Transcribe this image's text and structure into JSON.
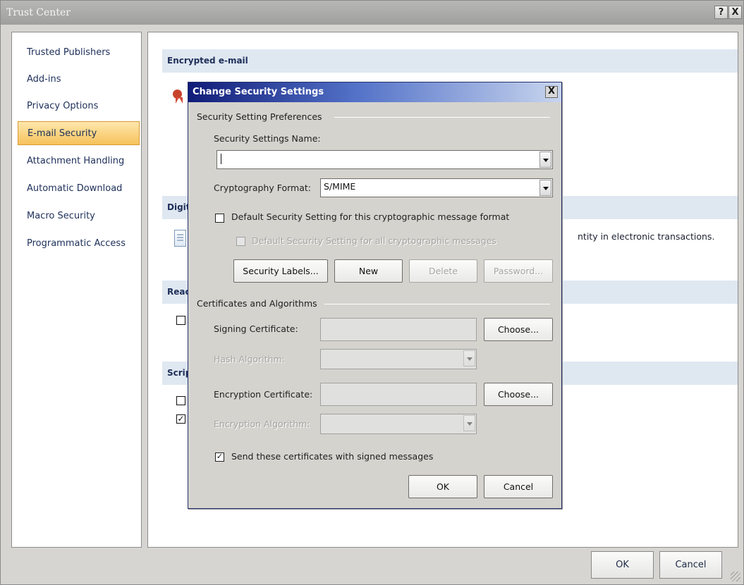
{
  "window": {
    "title": "Trust Center",
    "help_label": "?",
    "close_label": "X"
  },
  "sidebar": {
    "items": [
      {
        "label": "Trusted Publishers"
      },
      {
        "label": "Add-ins"
      },
      {
        "label": "Privacy Options"
      },
      {
        "label": "E-mail Security",
        "selected": true
      },
      {
        "label": "Attachment Handling"
      },
      {
        "label": "Automatic Download"
      },
      {
        "label": "Macro Security"
      },
      {
        "label": "Programmatic Access"
      }
    ]
  },
  "main": {
    "sections": [
      {
        "title": "Encrypted e-mail"
      },
      {
        "title": "Digit"
      },
      {
        "title": "Reac"
      },
      {
        "title": "Scrip"
      }
    ],
    "visible_text": {
      "digital_id_text": "ntity in electronic transactions."
    },
    "checkboxes": [
      {
        "checked": false
      },
      {
        "checked": false
      },
      {
        "checked": true
      }
    ]
  },
  "footer": {
    "ok_label": "OK",
    "cancel_label": "Cancel"
  },
  "dialog": {
    "title": "Change Security Settings",
    "close_label": "X",
    "preferences": {
      "group_label": "Security Setting Preferences",
      "name_label": "Security Settings Name:",
      "name_value": "",
      "crypto_label": "Cryptography Format:",
      "crypto_value": "S/MIME",
      "default_format_label": "Default Security Setting for this cryptographic message format",
      "default_format_checked": false,
      "default_all_label": "Default Security Setting for all cryptographic messages",
      "default_all_checked": false
    },
    "buttons": {
      "security_labels": "Security Labels...",
      "new": "New",
      "delete": "Delete",
      "password": "Password..."
    },
    "certificates": {
      "group_label": "Certificates and Algorithms",
      "signing_label": "Signing Certificate:",
      "choose_signing": "Choose...",
      "hash_label": "Hash Algorithm:",
      "encryption_label": "Encryption Certificate:",
      "choose_encryption": "Choose...",
      "encryption_algorithm_label": "Encryption Algorithm:",
      "send_certificates_label": "Send these certificates with signed messages",
      "send_certificates_checked": true
    },
    "actions": {
      "ok": "OK",
      "cancel": "Cancel"
    }
  }
}
